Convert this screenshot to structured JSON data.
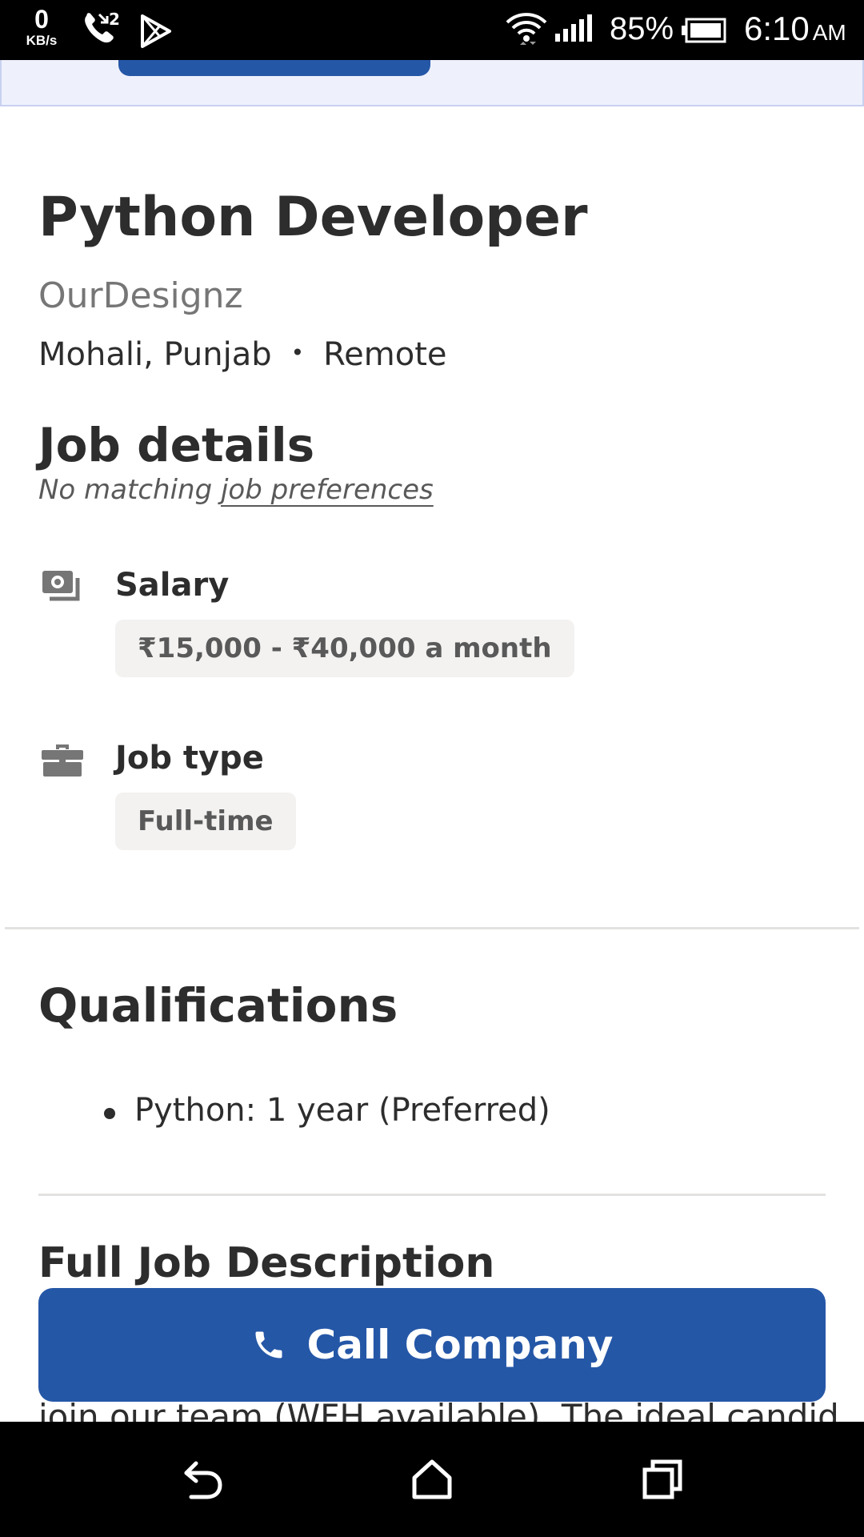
{
  "status_bar": {
    "net_speed_value": "0",
    "net_speed_unit": "KB/s",
    "call_badge": "2",
    "battery_percent": "85%",
    "time": "6:10",
    "ampm": "AM"
  },
  "job": {
    "title": "Python Developer",
    "company": "OurDesignz",
    "location": "Mohali, Punjab",
    "separator": "•",
    "work_mode": "Remote"
  },
  "job_details": {
    "heading": "Job details",
    "prefs_prefix": "No matching ",
    "prefs_link": "job preferences",
    "salary_label": "Salary",
    "salary_value": "₹15,000 - ₹40,000 a month",
    "job_type_label": "Job type",
    "job_type_value": "Full-time"
  },
  "qualifications": {
    "heading": "Qualifications",
    "items": [
      "Python: 1 year (Preferred)"
    ]
  },
  "full_description": {
    "heading": "Full Job Description",
    "peek_text": "join our team (WFH available). The ideal candidate"
  },
  "call_button": {
    "label": "Call Company"
  },
  "icons": {
    "salary": "money-icon",
    "job_type": "briefcase-icon",
    "call": "phone-icon"
  },
  "colors": {
    "accent": "#2557a7",
    "tag_bg": "#f3f2f1",
    "muted_text": "#767676"
  }
}
